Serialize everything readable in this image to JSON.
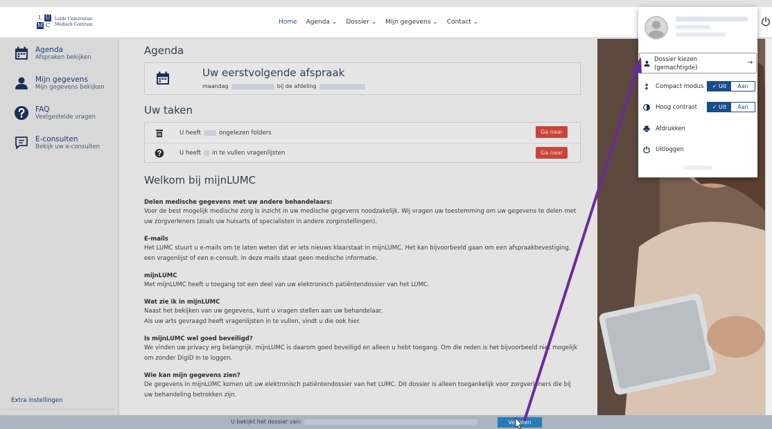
{
  "header": {
    "logo_letters": [
      "L",
      "U",
      "M",
      "C"
    ],
    "logo_line1": "Leids Universitair",
    "logo_line2": "Medisch Centrum",
    "nav": [
      {
        "label": "Home"
      },
      {
        "label": "Agenda ⌄"
      },
      {
        "label": "Dossier ⌄"
      },
      {
        "label": "Mijn gegevens ⌄"
      },
      {
        "label": "Contact ⌄"
      }
    ]
  },
  "sidebar": {
    "items": [
      {
        "title": "Agenda",
        "sub": "Afspraken bekijken",
        "icon": "calendar-icon"
      },
      {
        "title": "Mijn gegevens",
        "sub": "Mijn gegevens bekijken",
        "icon": "user-icon"
      },
      {
        "title": "FAQ",
        "sub": "Veelgestelde vragen",
        "icon": "question-icon"
      },
      {
        "title": "E-consulten",
        "sub": "Bekijk uw e-consulten",
        "icon": "message-icon"
      }
    ],
    "extra": "Extra instellingen"
  },
  "main": {
    "agenda_title": "Agenda",
    "appointment": {
      "title": "Uw eerstvolgende afspraak",
      "prefix": "maandag",
      "middle": "bij de afdeling"
    },
    "tasks_title": "Uw taken",
    "tasks": [
      {
        "before": "U heeft",
        "after": "ongelezen folders",
        "button": "Ga naar",
        "icon": "trash-icon"
      },
      {
        "before": "U heeft",
        "after": "in te vullen vragenlijsten",
        "button": "Ga naar",
        "icon": "question-icon"
      }
    ],
    "welcome_title": "Welkom bij mijnLUMC",
    "sections": [
      {
        "title": "Delen medische gegevens met uw andere behandelaars:",
        "body": "Voor de best mogelijk medische zorg is inzicht in uw medische gegevens noodzakelijk. Wij vragen uw toestemming om uw gegevens te delen met uw zorgverleners (zoals uw huisarts of specialisten in andere zorginstellingen)."
      },
      {
        "title": "E-mails",
        "body": "Het LUMC stuurt u e-mails om te laten weten dat er iets nieuws klaarstaat in mijnLUMC. Het kan bijvoorbeeld gaan om een afspraakbevestiging, een vragenlijst of een e-consult. In deze mails staat geen medische informatie."
      },
      {
        "title": "mijnLUMC",
        "body": "Met mijnLUMC heeft u toegang tot een deel van uw elektronisch patiëntendossier van het LUMC."
      },
      {
        "title": "Wat zie ik in mijnLUMC",
        "body": "Naast het bekijken van uw gegevens, kunt u vragen stellen aan uw behandelaar.\nAls uw arts gevraagd heeft vragenlijsten in te vullen, vindt u die ook hier."
      },
      {
        "title": "Is mijnLUMC wel goed beveiligd?",
        "body": "We vinden uw privacy erg belangrijk. mijnLUMC is daarom goed beveiligd en alleen u hebt toegang. Om die reden is het bijvoorbeeld niet mogelijk om zonder DigiD in te loggen."
      },
      {
        "title": "Wie kan mijn gegevens zien?",
        "body": "De gegevens in mijnLUMC komen uit uw elektronisch patiëntendossier van het LUMC. Dit dossier is alleen toegankelijk voor zorgverleners die bij uw behandeling betrokken zijn."
      }
    ]
  },
  "bottombar": {
    "text": "U bekijkt het dossier van:",
    "button": "Verlaten"
  },
  "dropdown": {
    "dossier_line1": "Dossier kiezen",
    "dossier_line2": "(gemachtigde)",
    "dossier_arrow": "→",
    "compact_label": "Compact modus",
    "contrast_label": "Hoog contrast",
    "toggle_on": "✓ Uit",
    "toggle_off": "Aan",
    "print_label": "Afdrukken",
    "logout_label": "Uitloggen"
  },
  "colors": {
    "brand": "#1a3a7a",
    "button_red": "#c9453b",
    "button_blue": "#2a7ab8",
    "annotation_arrow": "#6a2b9a"
  }
}
